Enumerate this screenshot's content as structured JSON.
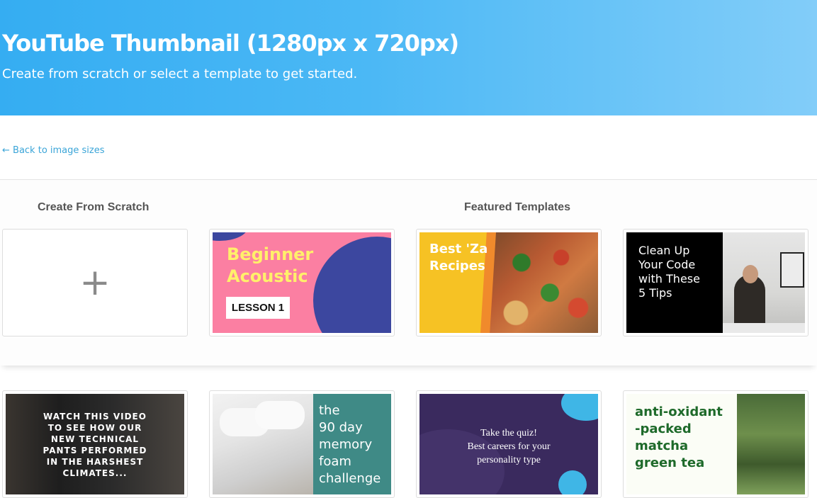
{
  "hero": {
    "title": "YouTube Thumbnail (1280px x 720px)",
    "subtitle": "Create from scratch or select a template to get started."
  },
  "nav": {
    "back_label": "← Back to image sizes"
  },
  "sections": {
    "scratch_title": "Create From Scratch",
    "featured_title": "Featured Templates"
  },
  "scratch": {
    "plus_glyph": "+"
  },
  "templates": [
    {
      "title": "Beginner\nAcoustic",
      "badge": "LESSON 1"
    },
    {
      "title": "Best 'Za\nRecipes"
    },
    {
      "title": "Clean Up\nYour Code\nwith These\n5 Tips"
    },
    {
      "title": "WATCH THIS VIDEO\nTO SEE HOW OUR\nNEW TECHNICAL\nPANTS PERFORMED\nIN THE HARSHEST\nCLIMATES..."
    },
    {
      "title": "the\n90 day\nmemory\nfoam\nchallenge"
    },
    {
      "title": "Take the quiz!\nBest careers for your\npersonality type"
    },
    {
      "title": "anti-oxidant\n-packed\nmatcha\ngreen tea"
    }
  ],
  "colors": {
    "hero_start": "#35adf2",
    "hero_end": "#82cdf9",
    "link": "#3ba5d8"
  }
}
